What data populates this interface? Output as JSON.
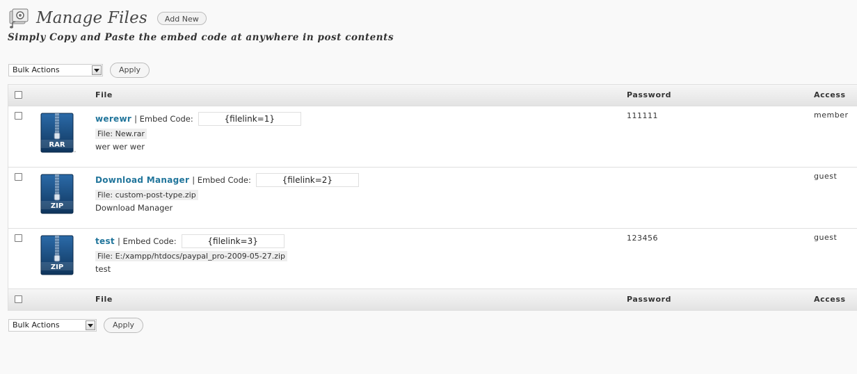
{
  "header": {
    "title": "Manage Files",
    "add_new_label": "Add New",
    "subtitle": "Simply Copy and Paste the embed code at anywhere in post contents"
  },
  "bulk_top": {
    "select_value": "Bulk Actions",
    "apply_label": "Apply"
  },
  "bulk_bottom": {
    "select_value": "Bulk Actions",
    "apply_label": "Apply"
  },
  "table": {
    "columns": {
      "file": "File",
      "password": "Password",
      "access": "Access"
    },
    "embed_label": "Embed Code:",
    "rows": [
      {
        "title": "werewr",
        "embed": "{filelink=1}",
        "file": "File: New.rar",
        "description": "wer wer wer",
        "password": "111111",
        "access": "member",
        "icon": "rar-archive-icon",
        "icon_label": "RAR"
      },
      {
        "title": "Download Manager",
        "embed": "{filelink=2}",
        "file": "File: custom-post-type.zip",
        "description": "Download Manager",
        "password": "",
        "access": "guest",
        "icon": "zip-archive-icon",
        "icon_label": "ZIP"
      },
      {
        "title": "test",
        "embed": "{filelink=3}",
        "file": "File: E:/xampp/htdocs/paypal_pro-2009-05-27.zip",
        "description": "test",
        "password": "123456",
        "access": "guest",
        "icon": "zip-archive-icon",
        "icon_label": "ZIP"
      }
    ]
  },
  "colors": {
    "link": "#21759b",
    "header_bg": "#e9e9e9",
    "page_bg": "#f9f9f9",
    "icon_blue": "#1c4f86"
  }
}
